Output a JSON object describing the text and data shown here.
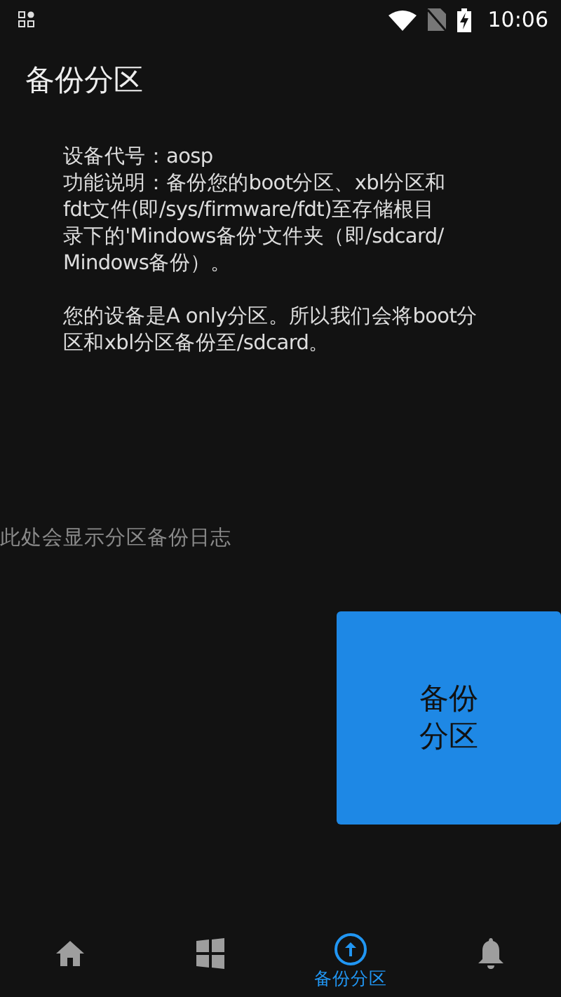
{
  "status_bar": {
    "time": "10:06"
  },
  "title": "备份分区",
  "info": {
    "lines": [
      "设备代号：aosp",
      "功能说明：备份您的boot分区、xbl分区和",
      "fdt文件(即/sys/firmware/fdt)至存储根目",
      "录下的'Mindows备份'文件夹（即/sdcard/",
      "Mindows备份）。"
    ],
    "note_lines": [
      "您的设备是A only分区。所以我们会将boot分",
      "区和xbl分区备份至/sdcard。"
    ]
  },
  "log_message": "此处会显示分区备份日志",
  "backup_button": "备份分区",
  "bottom_nav": [
    {
      "kind": "home",
      "selected": false
    },
    {
      "kind": "windows",
      "selected": false
    },
    {
      "kind": "backup",
      "label": "备份分区",
      "selected": true
    },
    {
      "kind": "bell",
      "selected": false
    }
  ]
}
